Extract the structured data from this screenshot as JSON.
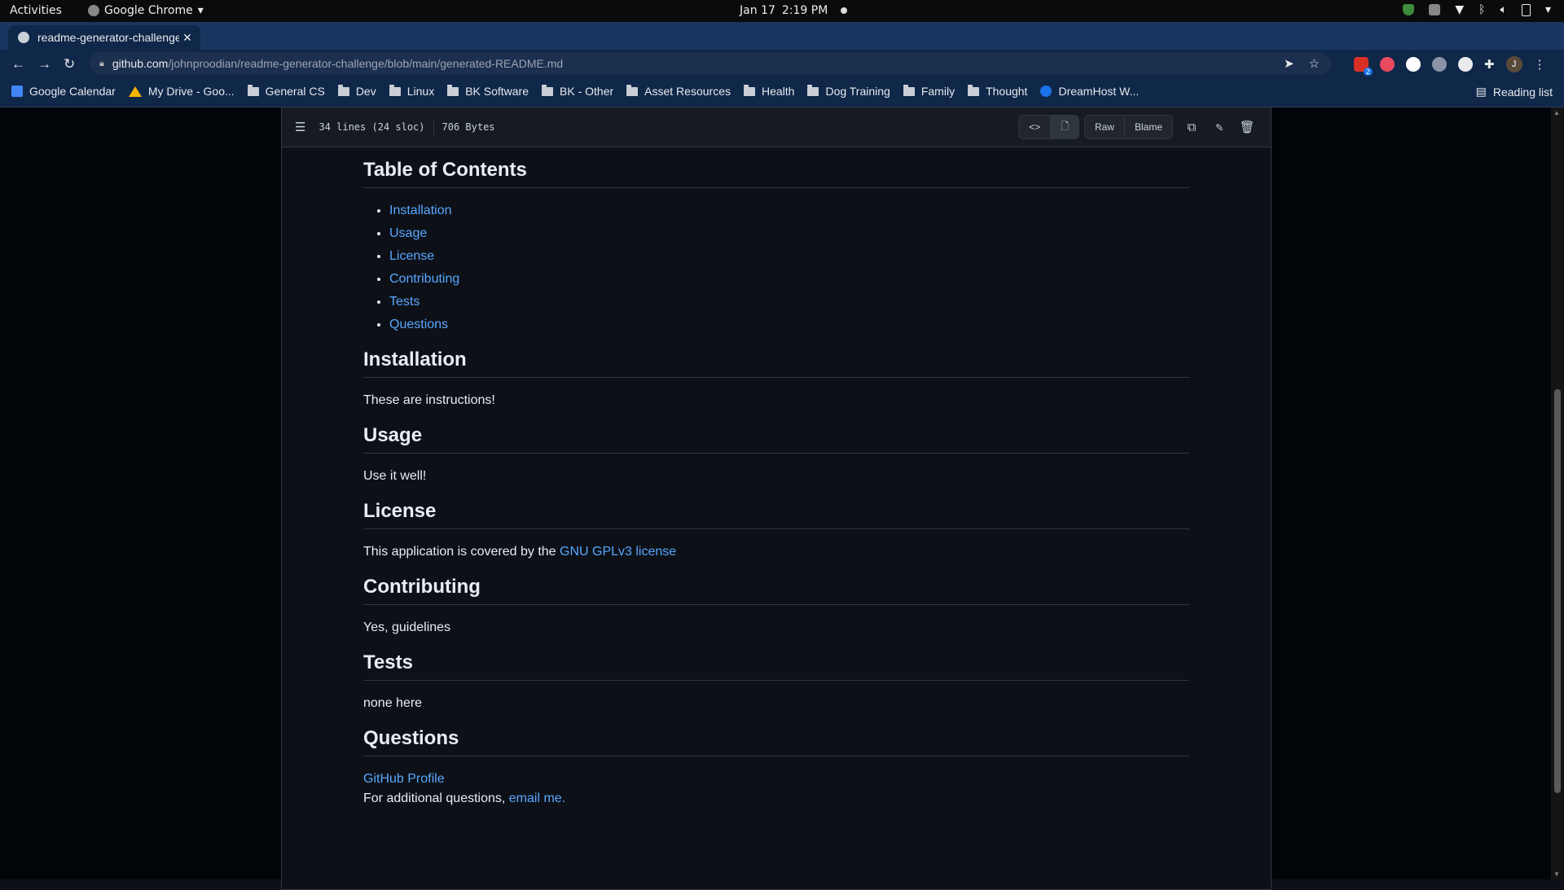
{
  "gnome": {
    "activities": "Activities",
    "app_name": "Google Chrome",
    "date": "Jan 17",
    "time": "2:19 PM"
  },
  "browser": {
    "tab_title": "readme-generator-challenge",
    "url_domain": "github.com",
    "url_path": "/johnproodian/readme-generator-challenge/blob/main/generated-README.md",
    "profile_initial": "J",
    "extension_badge": "2",
    "bookmarks": [
      {
        "label": "Google Calendar",
        "icon": "calendar-icon"
      },
      {
        "label": "My Drive - Goo...",
        "icon": "drive-icon"
      },
      {
        "label": "General CS",
        "icon": "folder-icon"
      },
      {
        "label": "Dev",
        "icon": "folder-icon"
      },
      {
        "label": "Linux",
        "icon": "folder-icon"
      },
      {
        "label": "BK Software",
        "icon": "folder-icon"
      },
      {
        "label": "BK - Other",
        "icon": "folder-icon"
      },
      {
        "label": "Asset Resources",
        "icon": "folder-icon"
      },
      {
        "label": "Health",
        "icon": "folder-icon"
      },
      {
        "label": "Dog Training",
        "icon": "folder-icon"
      },
      {
        "label": "Family",
        "icon": "folder-icon"
      },
      {
        "label": "Thought",
        "icon": "folder-icon"
      },
      {
        "label": "DreamHost W...",
        "icon": "dreamhost-icon"
      }
    ],
    "reading_list": "Reading list"
  },
  "file": {
    "lines": "34 lines (24 sloc)",
    "size": "706 Bytes",
    "raw_label": "Raw",
    "blame_label": "Blame"
  },
  "readme": {
    "toc_heading": "Table of Contents",
    "toc_items": [
      "Installation",
      "Usage",
      "License",
      "Contributing",
      "Tests",
      "Questions"
    ],
    "installation_heading": "Installation",
    "installation_text": "These are instructions!",
    "usage_heading": "Usage",
    "usage_text": "Use it well!",
    "license_heading": "License",
    "license_text": "This application is covered by the ",
    "license_link": "GNU GPLv3 license",
    "contributing_heading": "Contributing",
    "contributing_text": "Yes, guidelines",
    "tests_heading": "Tests",
    "tests_text": "none here",
    "questions_heading": "Questions",
    "github_link": "GitHub Profile",
    "questions_text": "For additional questions, ",
    "email_link": "email me."
  }
}
